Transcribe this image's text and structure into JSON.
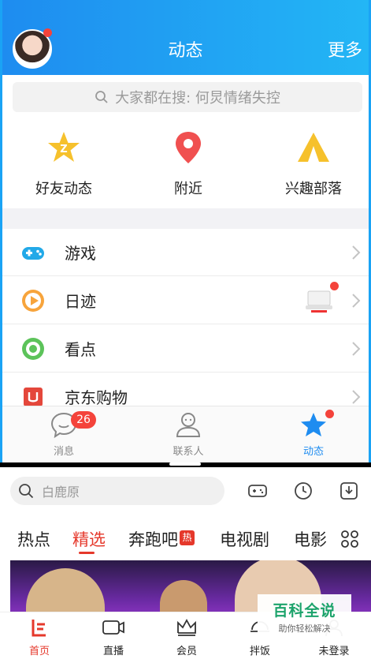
{
  "qq": {
    "header": {
      "title": "动态",
      "more": "更多"
    },
    "search": {
      "placeholder": "大家都在搜: 何炅情绪失控"
    },
    "features": [
      {
        "label": "好友动态",
        "icon": "qzone-star-icon"
      },
      {
        "label": "附近",
        "icon": "location-pin-icon"
      },
      {
        "label": "兴趣部落",
        "icon": "tent-icon"
      }
    ],
    "rows": [
      {
        "label": "游戏",
        "icon": "gamepad-icon"
      },
      {
        "label": "日迹",
        "icon": "play-circle-icon"
      },
      {
        "label": "看点",
        "icon": "eye-ring-icon"
      },
      {
        "label": "京东购物",
        "icon": "jd-shop-icon"
      }
    ],
    "tabbar": {
      "messages": {
        "label": "消息",
        "badge": "26"
      },
      "contacts": {
        "label": "联系人"
      },
      "dynamic": {
        "label": "动态"
      }
    }
  },
  "video": {
    "search": {
      "placeholder": "白鹿原"
    },
    "tabs": [
      "热点",
      "精选",
      "奔跑吧",
      "电视剧",
      "电影"
    ],
    "hot_badge": "热",
    "watermark": {
      "title": "百科全说",
      "subtitle": "助你轻松解决"
    },
    "nav": [
      {
        "label": "首页",
        "icon": "home-icon"
      },
      {
        "label": "直播",
        "icon": "camera-icon"
      },
      {
        "label": "会员",
        "icon": "crown-icon"
      },
      {
        "label": "拌饭",
        "icon": "bowl-icon"
      },
      {
        "label": "未登录",
        "icon": "user-icon"
      }
    ]
  },
  "colors": {
    "accent_blue": "#1e8cf0",
    "accent_red": "#e5382b",
    "badge_red": "#f4433b",
    "brand_green": "#1ca36b"
  }
}
